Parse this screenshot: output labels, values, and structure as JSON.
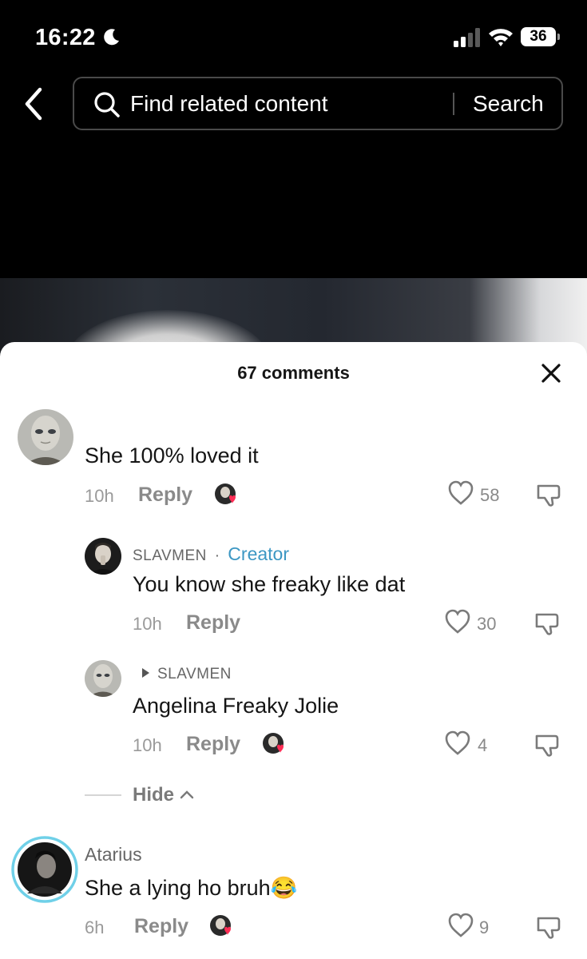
{
  "status_bar": {
    "time": "16:22",
    "battery": "36"
  },
  "search": {
    "placeholder": "Find related content",
    "button": "Search"
  },
  "sheet": {
    "title": "67 comments",
    "hide_label": "Hide"
  },
  "comments": [
    {
      "avatar": "alien-avatar",
      "text": "She 100% loved it",
      "time": "10h",
      "reply": "Reply",
      "likes": "58",
      "creator_liked": true
    },
    {
      "avatar": "creator-avatar",
      "username": "SLAVMEN",
      "separator": "·",
      "badge": "Creator",
      "text": "You know she freaky like dat",
      "time": "10h",
      "reply": "Reply",
      "likes": "30"
    },
    {
      "avatar": "alien-avatar",
      "reply_to": "SLAVMEN",
      "text": "Angelina Freaky Jolie",
      "time": "10h",
      "reply": "Reply",
      "likes": "4",
      "creator_liked": true
    },
    {
      "avatar": "atarius-avatar",
      "username": "Atarius",
      "text": "She a lying ho bruh😂",
      "time": "6h",
      "reply": "Reply",
      "likes": "9",
      "creator_liked": true
    }
  ],
  "colors": {
    "creator_badge": "#3c97c3",
    "like_heart": "#ff2d55",
    "story_ring": "#6fd0e8"
  }
}
